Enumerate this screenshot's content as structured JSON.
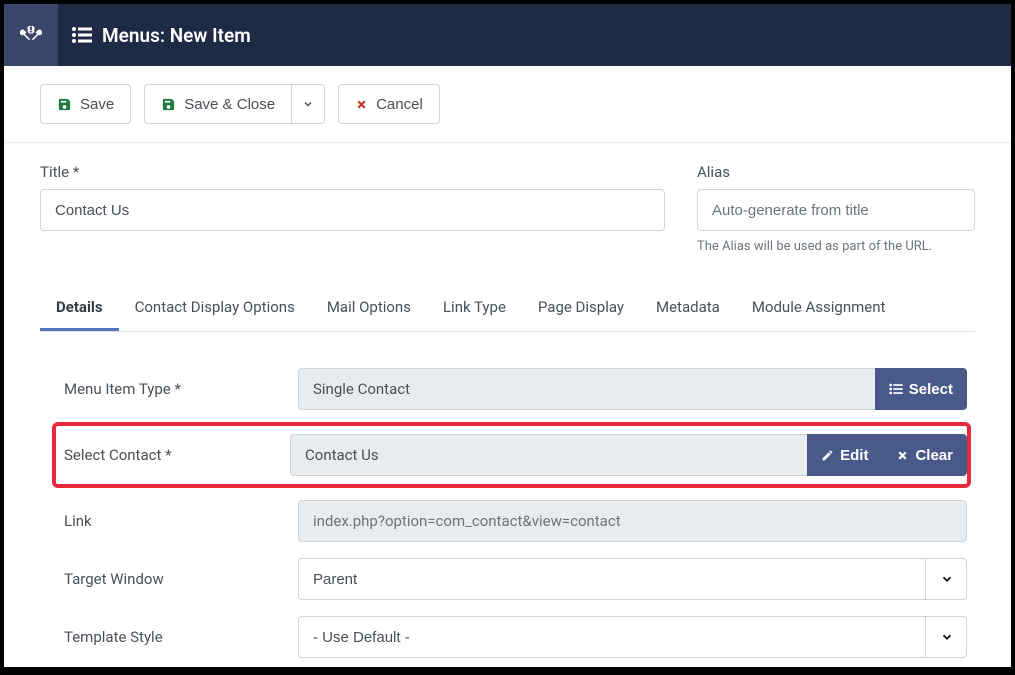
{
  "header": {
    "title": "Menus: New Item"
  },
  "toolbar": {
    "save": "Save",
    "save_close": "Save & Close",
    "cancel": "Cancel"
  },
  "title_section": {
    "title_label": "Title *",
    "title_value": "Contact Us",
    "alias_label": "Alias",
    "alias_placeholder": "Auto-generate from title",
    "alias_hint": "The Alias will be used as part of the URL."
  },
  "tabs": [
    {
      "label": "Details",
      "active": true
    },
    {
      "label": "Contact Display Options",
      "active": false
    },
    {
      "label": "Mail Options",
      "active": false
    },
    {
      "label": "Link Type",
      "active": false
    },
    {
      "label": "Page Display",
      "active": false
    },
    {
      "label": "Metadata",
      "active": false
    },
    {
      "label": "Module Assignment",
      "active": false
    }
  ],
  "details": {
    "menu_item_type": {
      "label": "Menu Item Type *",
      "value": "Single Contact",
      "select_btn": "Select"
    },
    "select_contact": {
      "label": "Select Contact *",
      "value": "Contact Us",
      "edit_btn": "Edit",
      "clear_btn": "Clear"
    },
    "link": {
      "label": "Link",
      "value": "index.php?option=com_contact&view=contact"
    },
    "target_window": {
      "label": "Target Window",
      "value": "Parent"
    },
    "template_style": {
      "label": "Template Style",
      "value": "- Use Default -"
    }
  },
  "colors": {
    "topbar": "#1f2a44",
    "logo_bg": "#3a476b",
    "action_btn": "#495a8a",
    "highlight": "#e8293b",
    "save_icon": "#1f7a3d",
    "cancel_icon": "#c0392b"
  }
}
